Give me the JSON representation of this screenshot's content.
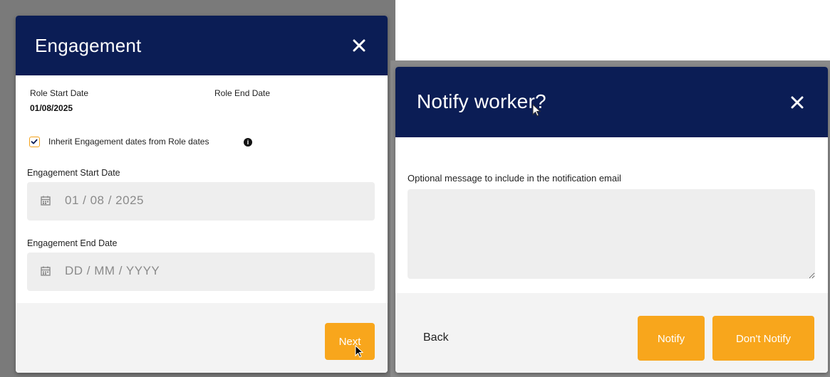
{
  "engagement_modal": {
    "title": "Engagement",
    "role_start_label": "Role Start Date",
    "role_start_value": "01/08/2025",
    "role_end_label": "Role End Date",
    "inherit_checkbox_label": "Inherit Engagement dates from Role dates",
    "inherit_checked": true,
    "start_date_label": "Engagement Start Date",
    "start_date_value": "01 / 08 / 2025",
    "end_date_label": "Engagement End Date",
    "end_date_placeholder": "DD / MM / YYYY",
    "next_label": "Next"
  },
  "notify_modal": {
    "title": "Notify worker?",
    "message_label": "Optional message to include in the notification email",
    "message_value": "",
    "back_label": "Back",
    "notify_label": "Notify",
    "dont_notify_label": "Don't Notify"
  },
  "colors": {
    "header_navy": "#0b1d55",
    "accent_orange": "#f8a61c",
    "input_bg": "#eeeeee"
  }
}
